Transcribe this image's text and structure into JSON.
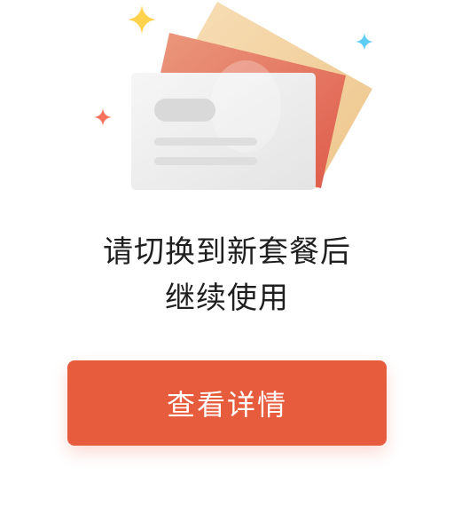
{
  "illustration": {
    "icon": "stacked-plan-cards-illustration",
    "sparkle_colors": [
      "#ffd24d",
      "#5ecdf5",
      "#f3735d"
    ]
  },
  "message": {
    "line1": "请切换到新套餐后",
    "line2": "继续使用"
  },
  "action": {
    "label": "查看详情",
    "color": "#e85c3e"
  }
}
